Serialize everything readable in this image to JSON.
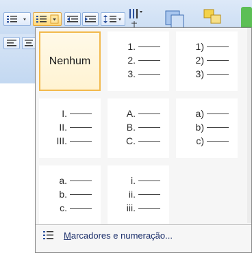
{
  "ribbon": {
    "buttons": [
      {
        "name": "bullets-button",
        "icon": "bullet-list-icon"
      },
      {
        "name": "numbering-button",
        "icon": "numbered-list-icon"
      },
      {
        "name": "decrease-indent-button",
        "icon": "decrease-indent-icon"
      },
      {
        "name": "increase-indent-button",
        "icon": "increase-indent-icon"
      },
      {
        "name": "line-spacing-button",
        "icon": "line-spacing-icon"
      },
      {
        "name": "text-direction-button",
        "icon": "text-direction-icon"
      },
      {
        "name": "shapes-button",
        "icon": "shapes-icon"
      },
      {
        "name": "arrange-button",
        "icon": "arrange-icon"
      }
    ]
  },
  "numbering_library": {
    "none_label": "Nenhum",
    "formats": [
      {
        "markers": [
          "1.",
          "2.",
          "3."
        ]
      },
      {
        "markers": [
          "1)",
          "2)",
          "3)"
        ]
      },
      {
        "markers": [
          "I.",
          "II.",
          "III."
        ]
      },
      {
        "markers": [
          "A.",
          "B.",
          "C."
        ]
      },
      {
        "markers": [
          "a)",
          "b)",
          "c)"
        ]
      },
      {
        "markers": [
          "a.",
          "b.",
          "c."
        ]
      },
      {
        "markers": [
          "i.",
          "ii.",
          "iii."
        ]
      }
    ]
  },
  "footer": {
    "label_accel": "M",
    "label_rest": "arcadores e numeração..."
  },
  "colors": {
    "selection_border": "#f2b94b",
    "link_text": "#1c2f6b"
  }
}
